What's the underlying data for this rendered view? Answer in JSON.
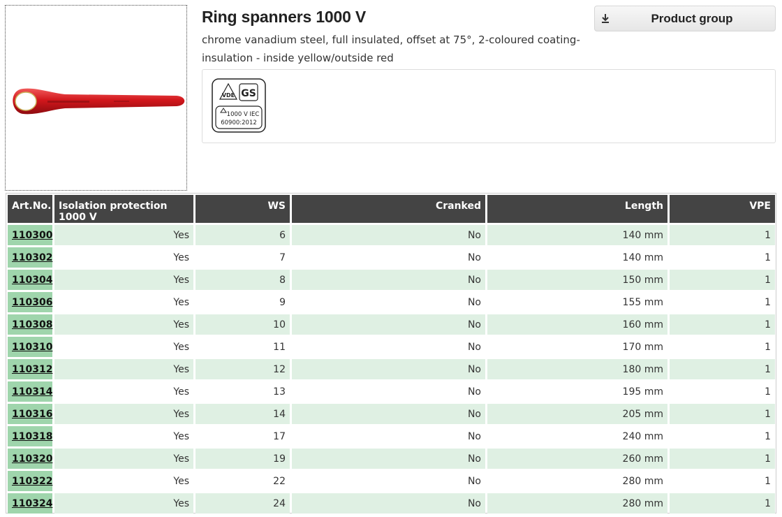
{
  "product": {
    "title": "Ring spanners 1000 V",
    "description": "chrome vanadium steel, full insulated, offset at 75°, 2-coloured coating-insulation - inside yellow/outside red",
    "image_alt": "red insulated ring spanner"
  },
  "header_button": {
    "label": "Product group",
    "icon": "download-icon"
  },
  "certification": {
    "logo_text_line1": "1000 V IEC",
    "logo_text_line2": "60900:2012",
    "logo_vde": "VDE",
    "logo_gs": "GS"
  },
  "table": {
    "columns": [
      "Art.No.",
      "Isolation protection 1000 V",
      "WS",
      "Cranked",
      "Length",
      "VPE"
    ],
    "rows": [
      [
        "110300",
        "Yes",
        "6",
        "No",
        "140 mm",
        "1"
      ],
      [
        "110302",
        "Yes",
        "7",
        "No",
        "140 mm",
        "1"
      ],
      [
        "110304",
        "Yes",
        "8",
        "No",
        "150 mm",
        "1"
      ],
      [
        "110306",
        "Yes",
        "9",
        "No",
        "155 mm",
        "1"
      ],
      [
        "110308",
        "Yes",
        "10",
        "No",
        "160 mm",
        "1"
      ],
      [
        "110310",
        "Yes",
        "11",
        "No",
        "170 mm",
        "1"
      ],
      [
        "110312",
        "Yes",
        "12",
        "No",
        "180 mm",
        "1"
      ],
      [
        "110314",
        "Yes",
        "13",
        "No",
        "195 mm",
        "1"
      ],
      [
        "110316",
        "Yes",
        "14",
        "No",
        "205 mm",
        "1"
      ],
      [
        "110318",
        "Yes",
        "17",
        "No",
        "240 mm",
        "1"
      ],
      [
        "110320",
        "Yes",
        "19",
        "No",
        "260 mm",
        "1"
      ],
      [
        "110322",
        "Yes",
        "22",
        "No",
        "280 mm",
        "1"
      ],
      [
        "110324",
        "Yes",
        "24",
        "No",
        "280 mm",
        "1"
      ]
    ]
  },
  "colors": {
    "header_bg": "#444444",
    "art_cell_bg": "#9fd5ac",
    "row_stripe_bg": "#dff0e3",
    "spanner_red": "#d2171c"
  }
}
